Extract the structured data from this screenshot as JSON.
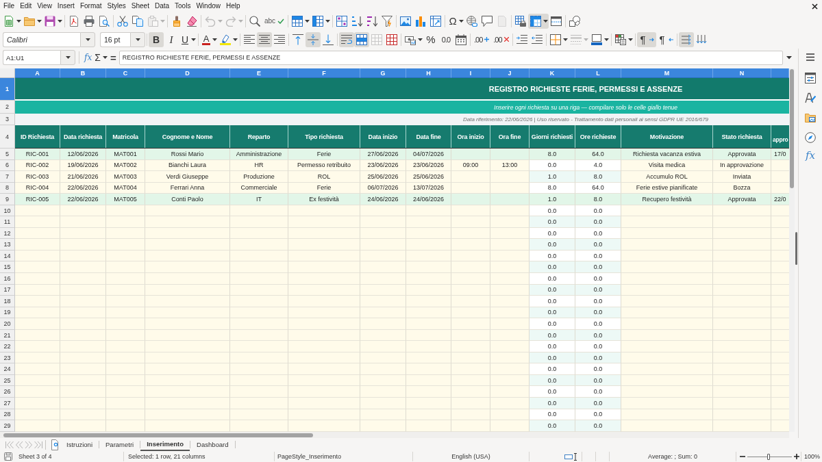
{
  "menu_bar": [
    "File",
    "Edit",
    "View",
    "Insert",
    "Format",
    "Styles",
    "Sheet",
    "Data",
    "Tools",
    "Window",
    "Help"
  ],
  "standard_toolbar": [
    [
      {
        "kind": "split",
        "pressed": false,
        "disabled": false
      },
      {
        "kind": "split",
        "pressed": false,
        "disabled": false
      },
      {
        "kind": "split",
        "pressed": false,
        "disabled": false
      }
    ],
    [
      {
        "kind": "plain",
        "pressed": false,
        "disabled": false
      },
      {
        "kind": "plain",
        "pressed": false,
        "disabled": false
      },
      {
        "kind": "plain",
        "pressed": false,
        "disabled": false
      }
    ],
    [
      {
        "kind": "plain",
        "pressed": false,
        "disabled": false
      },
      {
        "kind": "plain",
        "pressed": false,
        "disabled": false
      },
      {
        "kind": "split",
        "pressed": false,
        "disabled": true
      }
    ],
    [
      {
        "kind": "plain",
        "pressed": false,
        "disabled": false
      },
      {
        "kind": "plain",
        "pressed": false,
        "disabled": false
      }
    ],
    [
      {
        "kind": "split",
        "pressed": false,
        "disabled": true
      },
      {
        "kind": "split",
        "pressed": false,
        "disabled": true
      }
    ],
    [
      {
        "kind": "plain",
        "pressed": false,
        "disabled": false
      },
      {
        "kind": "plain",
        "glyph": "abc",
        "pressed": false,
        "disabled": false
      }
    ],
    [
      {
        "kind": "split",
        "pressed": false,
        "disabled": false
      },
      {
        "kind": "split",
        "pressed": false,
        "disabled": false
      }
    ],
    [
      {
        "kind": "plain",
        "pressed": false,
        "disabled": false
      },
      {
        "kind": "plain",
        "pressed": false,
        "disabled": false
      },
      {
        "kind": "plain",
        "pressed": false,
        "disabled": false
      },
      {
        "kind": "plain",
        "pressed": false,
        "disabled": false
      }
    ],
    [
      {
        "kind": "plain",
        "pressed": false,
        "disabled": false
      },
      {
        "kind": "plain",
        "pressed": false,
        "disabled": false
      },
      {
        "kind": "plain",
        "pressed": false,
        "disabled": false
      }
    ],
    [
      {
        "kind": "split",
        "glyph": "Ω",
        "pressed": false,
        "disabled": false
      },
      {
        "kind": "plain",
        "pressed": false,
        "disabled": false
      },
      {
        "kind": "plain",
        "pressed": false,
        "disabled": false
      },
      {
        "kind": "plain",
        "pressed": false,
        "disabled": true
      }
    ],
    [
      {
        "kind": "plain",
        "pressed": false,
        "disabled": false
      },
      {
        "kind": "split",
        "pressed": true,
        "disabled": false
      },
      {
        "kind": "plain",
        "pressed": false,
        "disabled": false
      }
    ],
    [
      {
        "kind": "plain",
        "pressed": false,
        "disabled": false
      }
    ]
  ],
  "formatting_toolbar": {
    "font_name": "Calibri",
    "font_size": "16 pt",
    "groups": [
      [
        {
          "kind": "plain",
          "glyph": "B",
          "pressed": true,
          "disabled": false
        },
        {
          "kind": "plain",
          "glyph": "I",
          "pressed": false,
          "disabled": false
        },
        {
          "kind": "split",
          "glyph": "U",
          "pressed": false,
          "disabled": false
        }
      ],
      [
        {
          "kind": "split",
          "glyph": "A",
          "pressed": false,
          "disabled": false
        },
        {
          "kind": "split",
          "pressed": false,
          "disabled": false
        }
      ],
      [
        {
          "kind": "plain",
          "pressed": false,
          "disabled": false
        },
        {
          "kind": "plain",
          "pressed": true,
          "disabled": false
        },
        {
          "kind": "plain",
          "pressed": false,
          "disabled": false
        }
      ],
      [
        {
          "kind": "plain",
          "pressed": false,
          "disabled": false
        },
        {
          "kind": "plain",
          "pressed": true,
          "disabled": false
        },
        {
          "kind": "plain",
          "pressed": false,
          "disabled": false
        }
      ],
      [
        {
          "kind": "plain",
          "pressed": true,
          "disabled": false
        },
        {
          "kind": "plain",
          "pressed": true,
          "disabled": false
        },
        {
          "kind": "plain",
          "pressed": false,
          "disabled": true
        },
        {
          "kind": "plain",
          "pressed": false,
          "disabled": false
        }
      ],
      [
        {
          "kind": "split",
          "pressed": false,
          "disabled": false
        },
        {
          "kind": "plain",
          "glyph": "%",
          "pressed": false,
          "disabled": false
        },
        {
          "kind": "plain",
          "glyph": "0.0",
          "pressed": false,
          "disabled": false
        },
        {
          "kind": "plain",
          "pressed": false,
          "disabled": false
        }
      ],
      [
        {
          "kind": "plain",
          "glyph": ".00",
          "pressed": false,
          "disabled": false
        },
        {
          "kind": "plain",
          "glyph": ".00",
          "pressed": false,
          "disabled": false
        }
      ],
      [
        {
          "kind": "plain",
          "pressed": false,
          "disabled": false
        },
        {
          "kind": "plain",
          "pressed": false,
          "disabled": false
        }
      ],
      [
        {
          "kind": "split",
          "pressed": false,
          "disabled": false
        },
        {
          "kind": "split",
          "pressed": false,
          "disabled": true
        },
        {
          "kind": "split",
          "pressed": false,
          "disabled": false
        }
      ],
      [
        {
          "kind": "split",
          "pressed": false,
          "disabled": false
        }
      ],
      [
        {
          "kind": "plain",
          "glyph": "¶",
          "pressed": true,
          "disabled": false
        },
        {
          "kind": "plain",
          "glyph": "¶",
          "pressed": false,
          "disabled": false
        }
      ],
      [
        {
          "kind": "plain",
          "pressed": true,
          "disabled": false
        },
        {
          "kind": "plain",
          "pressed": false,
          "disabled": false
        }
      ]
    ]
  },
  "formula_bar": {
    "name_box": "A1:U1",
    "function_wizard": "fx",
    "sum": "Σ",
    "formula": "=",
    "content": "REGISTRO RICHIESTE FERIE, PERMESSI E ASSENZE"
  },
  "sheet": {
    "columns": [
      {
        "label": "A",
        "selected": true
      },
      {
        "label": "B",
        "selected": true
      },
      {
        "label": "C",
        "selected": true
      },
      {
        "label": "D",
        "selected": true
      },
      {
        "label": "E",
        "selected": true
      },
      {
        "label": "F",
        "selected": true
      },
      {
        "label": "G",
        "selected": true
      },
      {
        "label": "H",
        "selected": true
      },
      {
        "label": "I",
        "selected": true
      },
      {
        "label": "J",
        "selected": true
      },
      {
        "label": "K",
        "selected": true
      },
      {
        "label": "L",
        "selected": true
      },
      {
        "label": "M",
        "selected": true
      },
      {
        "label": "N",
        "selected": true
      },
      {
        "selected": true
      }
    ],
    "title": {
      "row": "1",
      "selected": true,
      "text": "REGISTRO RICHIESTE FERIE, PERMESSI E ASSENZE"
    },
    "subtitle": {
      "row": "2",
      "selected": false,
      "text": "Inserire ogni richiesta su una riga — compilare solo le celle giallo tenue"
    },
    "note": {
      "row": "3",
      "selected": false,
      "text": "Data riferimento: 22/06/2026 | Uso riservato - Trattamento dati personali ai sensi GDPR UE 2016/679"
    },
    "header": {
      "row": "4",
      "selected": false,
      "cells": [
        "ID Richiesta",
        "Data richiesta",
        "Matricola",
        "Cognome e Nome",
        "Reparto",
        "Tipo richiesta",
        "Data inizio",
        "Data fine",
        "Ora inizio",
        "Ora fine",
        "Giorni richiesti",
        "Ore richieste",
        "Motivazione",
        "Stato richiesta",
        "appro"
      ]
    },
    "rows": [
      {
        "row": "5",
        "selected": false,
        "color": "#e2f6e8",
        "cells": {
          "id_richiesta": "RIC-001",
          "data_richiesta": "12/06/2026",
          "matricola": "MAT001",
          "cognome_e_nome": "Rossi Mario",
          "reparto": "Amministrazione",
          "tipo_richiesta": "Ferie",
          "data_inizio": "27/06/2026",
          "data_fine": "04/07/2026",
          "giorni_richiesti": "8.0",
          "ore_richieste": "64.0",
          "motivazione": "Richiesta vacanza estiva",
          "stato_richiesta": "Approvata",
          "column_15": "17/0"
        }
      },
      {
        "row": "6",
        "selected": false,
        "cells": {
          "id_richiesta": "RIC-002",
          "data_richiesta": "19/06/2026",
          "matricola": "MAT002",
          "cognome_e_nome": "Bianchi Laura",
          "reparto": "HR",
          "tipo_richiesta": "Permesso retribuito",
          "data_inizio": "23/06/2026",
          "data_fine": "23/06/2026",
          "ora_inizio": "09:00",
          "ora_fine": "13:00",
          "giorni_richiesti": "0.0",
          "ore_richieste": "4.0",
          "motivazione": "Visita medica",
          "stato_richiesta": "In approvazione"
        }
      },
      {
        "row": "7",
        "selected": false,
        "cells": {
          "id_richiesta": "RIC-003",
          "data_richiesta": "21/06/2026",
          "matricola": "MAT003",
          "cognome_e_nome": "Verdi Giuseppe",
          "reparto": "Produzione",
          "tipo_richiesta": "ROL",
          "data_inizio": "25/06/2026",
          "data_fine": "25/06/2026",
          "giorni_richiesti": "1.0",
          "ore_richieste": "8.0",
          "motivazione": "Accumulo ROL",
          "stato_richiesta": "Inviata"
        }
      },
      {
        "row": "8",
        "selected": false,
        "cells": {
          "id_richiesta": "RIC-004",
          "data_richiesta": "22/06/2026",
          "matricola": "MAT004",
          "cognome_e_nome": "Ferrari Anna",
          "reparto": "Commerciale",
          "tipo_richiesta": "Ferie",
          "data_inizio": "06/07/2026",
          "data_fine": "13/07/2026",
          "giorni_richiesti": "8.0",
          "ore_richieste": "64.0",
          "motivazione": "Ferie estive pianificate",
          "stato_richiesta": "Bozza"
        }
      },
      {
        "row": "9",
        "selected": false,
        "color": "#e2f6e8",
        "cells": {
          "id_richiesta": "RIC-005",
          "data_richiesta": "22/06/2026",
          "matricola": "MAT005",
          "cognome_e_nome": "Conti Paolo",
          "reparto": "IT",
          "tipo_richiesta": "Ex festività",
          "data_inizio": "24/06/2026",
          "data_fine": "24/06/2026",
          "giorni_richiesti": "1.0",
          "ore_richieste": "8.0",
          "motivazione": "Recupero festività",
          "stato_richiesta": "Approvata",
          "column_15": "22/0"
        }
      },
      {
        "row": "10",
        "selected": false,
        "cells": {
          "giorni_richiesti": "0.0",
          "ore_richieste": "0.0"
        }
      },
      {
        "row": "11",
        "selected": false,
        "cells": {
          "giorni_richiesti": "0.0",
          "ore_richieste": "0.0"
        }
      },
      {
        "row": "12",
        "selected": false,
        "cells": {
          "giorni_richiesti": "0.0",
          "ore_richieste": "0.0"
        }
      },
      {
        "row": "13",
        "selected": false,
        "cells": {
          "giorni_richiesti": "0.0",
          "ore_richieste": "0.0"
        }
      },
      {
        "row": "14",
        "selected": false,
        "cells": {
          "giorni_richiesti": "0.0",
          "ore_richieste": "0.0"
        }
      },
      {
        "row": "15",
        "selected": false,
        "cells": {
          "giorni_richiesti": "0.0",
          "ore_richieste": "0.0"
        }
      },
      {
        "row": "16",
        "selected": false,
        "cells": {
          "giorni_richiesti": "0.0",
          "ore_richieste": "0.0"
        }
      },
      {
        "row": "17",
        "selected": false,
        "cells": {
          "giorni_richiesti": "0.0",
          "ore_richieste": "0.0"
        }
      },
      {
        "row": "18",
        "selected": false,
        "cells": {
          "giorni_richiesti": "0.0",
          "ore_richieste": "0.0"
        }
      },
      {
        "row": "19",
        "selected": false,
        "cells": {
          "giorni_richiesti": "0.0",
          "ore_richieste": "0.0"
        }
      },
      {
        "row": "20",
        "selected": false,
        "cells": {
          "giorni_richiesti": "0.0",
          "ore_richieste": "0.0"
        }
      },
      {
        "row": "21",
        "selected": false,
        "cells": {
          "giorni_richiesti": "0.0",
          "ore_richieste": "0.0"
        }
      },
      {
        "row": "22",
        "selected": false,
        "cells": {
          "giorni_richiesti": "0.0",
          "ore_richieste": "0.0"
        }
      },
      {
        "row": "23",
        "selected": false,
        "cells": {
          "giorni_richiesti": "0.0",
          "ore_richieste": "0.0"
        }
      },
      {
        "row": "24",
        "selected": false,
        "cells": {
          "giorni_richiesti": "0.0",
          "ore_richieste": "0.0"
        }
      },
      {
        "row": "25",
        "selected": false,
        "cells": {
          "giorni_richiesti": "0.0",
          "ore_richieste": "0.0"
        }
      },
      {
        "row": "26",
        "selected": false,
        "cells": {
          "giorni_richiesti": "0.0",
          "ore_richieste": "0.0"
        }
      },
      {
        "row": "27",
        "selected": false,
        "cells": {
          "giorni_richiesti": "0.0",
          "ore_richieste": "0.0"
        }
      },
      {
        "row": "28",
        "selected": false,
        "cells": {
          "giorni_richiesti": "0.0",
          "ore_richieste": "0.0"
        }
      },
      {
        "row": "29",
        "selected": false,
        "cells": {
          "giorni_richiesti": "0.0",
          "ore_richieste": "0.0"
        }
      }
    ]
  },
  "sheet_tabs": [
    {
      "label": "Istruzioni",
      "selected": false
    },
    {
      "label": "Parametri",
      "selected": false
    },
    {
      "label": "Inserimento",
      "selected": true
    },
    {
      "label": "Dashboard",
      "selected": false
    }
  ],
  "sidebar": {
    "functions": "fx"
  },
  "status_bar": {
    "sheet": "Sheet 3 of 4",
    "selection": "Selected: 1 row, 21 columns",
    "page_style": "PageStyle_Inserimento",
    "language": "English (USA)",
    "summary": "Average: ; Sum: 0",
    "zoom": {
      "level": 0.48,
      "reading": "100%"
    }
  }
}
